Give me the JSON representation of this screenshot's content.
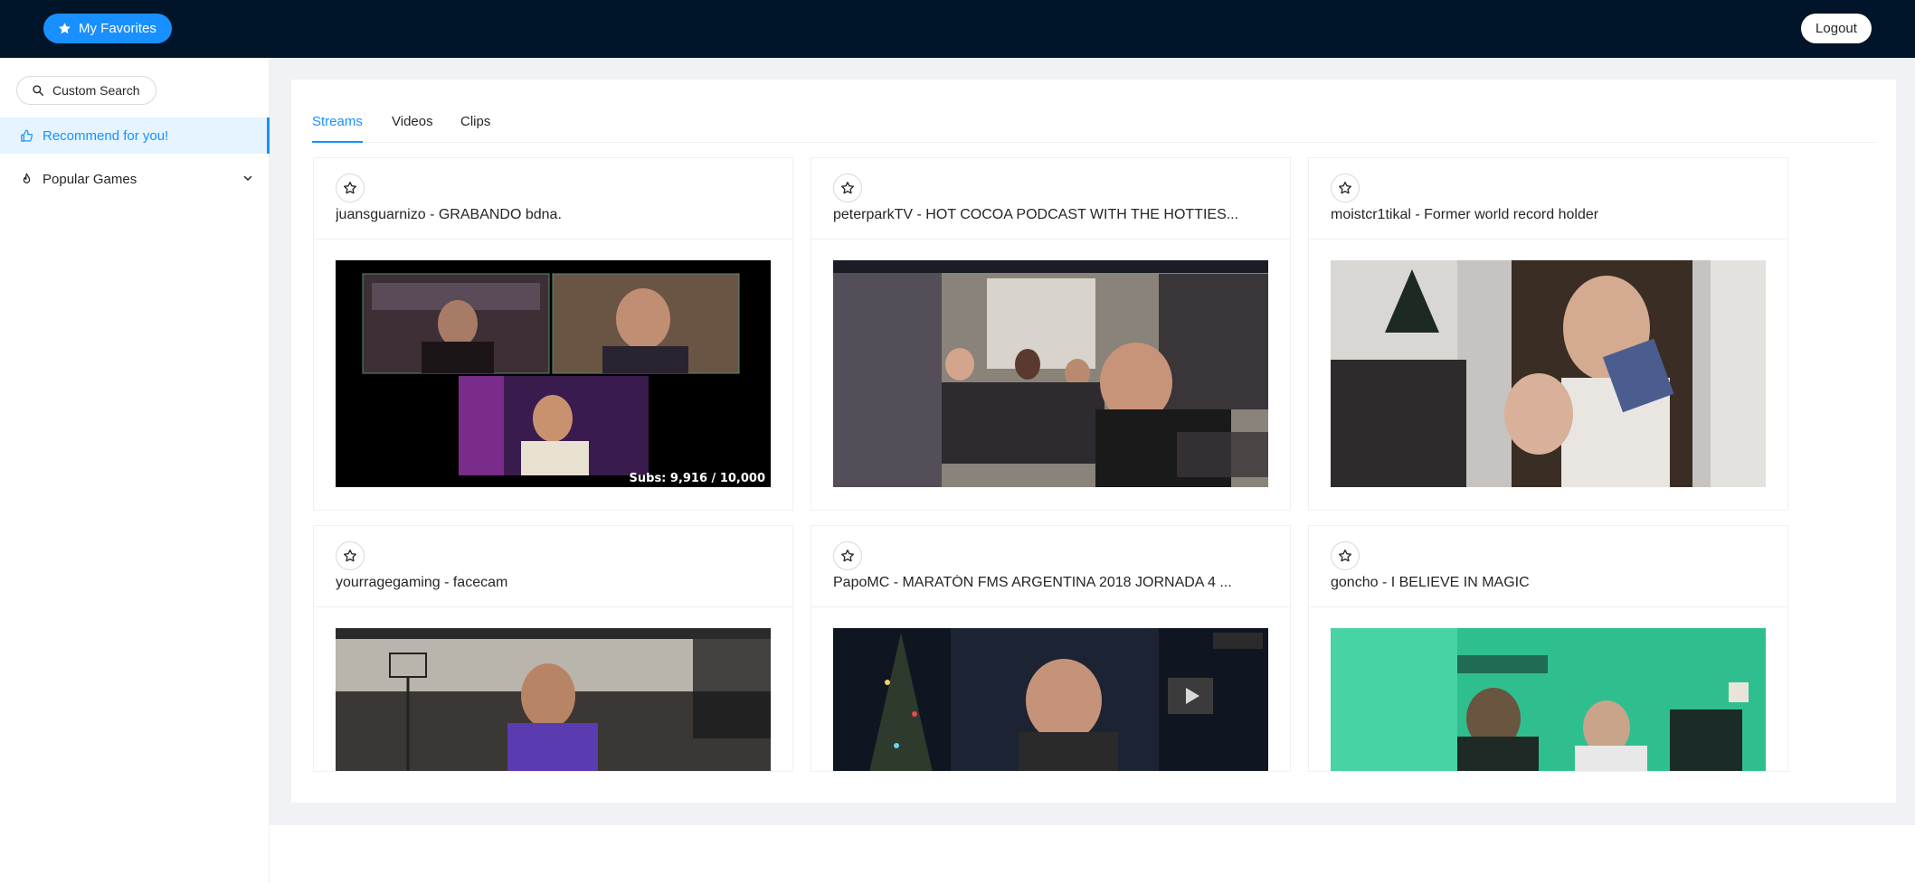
{
  "header": {
    "favorites_label": "My Favorites",
    "logout_label": "Logout"
  },
  "sidebar": {
    "search_label": "Custom Search",
    "items": [
      {
        "label": "Recommend for you!",
        "icon": "thumbs-up-icon",
        "active": true
      },
      {
        "label": "Popular Games",
        "icon": "fire-icon",
        "active": false
      }
    ]
  },
  "tabs": [
    {
      "label": "Streams",
      "active": true
    },
    {
      "label": "Videos",
      "active": false
    },
    {
      "label": "Clips",
      "active": false
    }
  ],
  "streams": [
    {
      "title": "juansguarnizo - GRABANDO bdna.",
      "overlay": "Subs: 9,916   / 10,000"
    },
    {
      "title": "peterparkTV - HOT COCOA PODCAST WITH THE HOTTIES..."
    },
    {
      "title": "moistcr1tikal - Former world record holder"
    },
    {
      "title": "yourragegaming - facecam"
    },
    {
      "title": "PapoMC - MARATÓN FMS ARGENTINA 2018 JORNADA 4 ..."
    },
    {
      "title": "goncho - I BELIEVE IN MAGIC"
    }
  ],
  "colors": {
    "header_bg": "#001529",
    "accent": "#1890ff",
    "content_bg": "#f0f2f5"
  }
}
